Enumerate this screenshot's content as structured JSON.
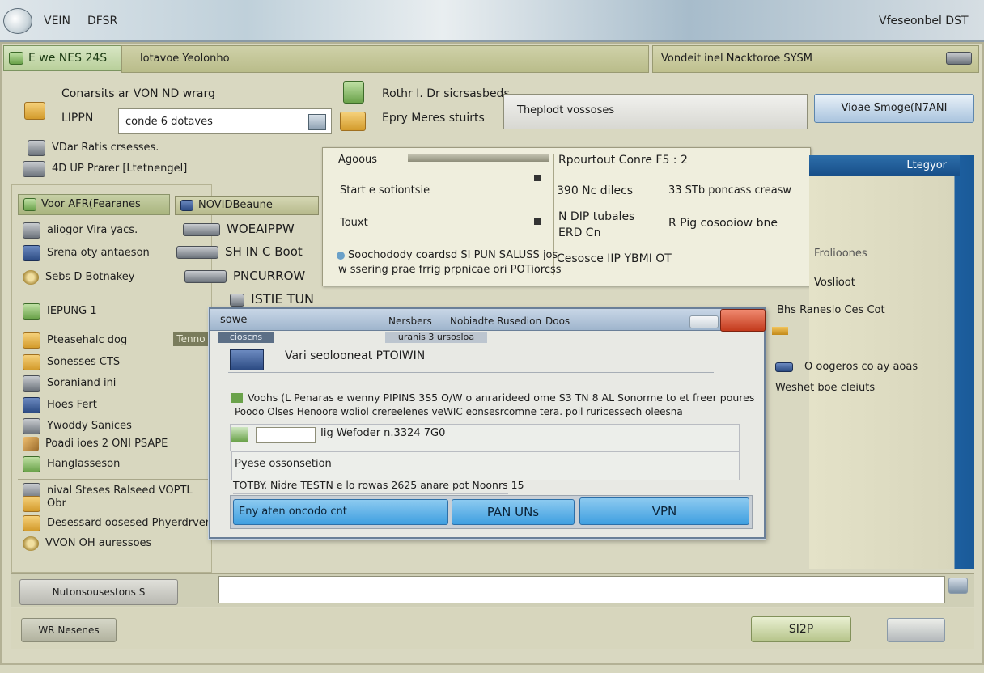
{
  "titlebar": {
    "left_text_1": "VEIN",
    "left_text_2": "DFSR",
    "right_text": "Vfeseonbel DST"
  },
  "topbar": {
    "tab_label": "E we NES 24S",
    "left_title": "lotavoe Yeolonho",
    "right_title": "Vondeit inel Nacktoroe SYSM"
  },
  "connect": {
    "label_1": "Conarsits ar VON ND wrarg",
    "label_2": "LIPPN",
    "input_value": "conde 6 dotaves"
  },
  "vpn_info": {
    "label_1": "Rothr I. Dr sicrsasbeds",
    "label_2": "Epry Meres stuirts",
    "search_value": "Theplodt vossoses"
  },
  "top_button": {
    "label": "Vioae Smoge(N7ANI"
  },
  "options": {
    "item_1": "VDar Ratis crsesses.",
    "item_2": "4D UP Prarer [Ltetnengel]"
  },
  "left_tree": {
    "header_1": "Voor AFR(Fearanes",
    "items_a": [
      "aliogor Vira yacs.",
      "Srena oty antaeson",
      "Sebs D Botnakey"
    ],
    "group_1": "IEPUNG 1",
    "items_b": [
      "Pteasehalc dog",
      "Sonesses CTS",
      "Soraniand ini",
      "Hoes Fert",
      "Ywoddy Sanices",
      "Poadi ioes 2 ONI PSAPE",
      "Hanglasseson"
    ],
    "group_2": "nival Steses Ralseed VOPTL",
    "items_c": [
      "Obr",
      "Desessard oosesed Phyerdrver",
      "VVON OH auressoes"
    ]
  },
  "mid_tree": {
    "header": "NOVIDBeaune",
    "items": [
      "WOEAIPPW",
      "SH IN C Boot",
      "PNCURROW",
      "ISTIE TUN"
    ],
    "tag": "Tenno"
  },
  "info_panel": {
    "col1": [
      "Agoous",
      "Start e sotiontsie",
      "Touxt"
    ],
    "footer_1": "Soochodody coardsd SI PUN SALUSS jos",
    "footer_2": "w ssering prae frrig prpnicae ori POTiorcss",
    "col2_head": "Rpourtout Conre F5 : 2",
    "col2": [
      "390 Nc dilecs",
      "N DIP tubales",
      "ERD Cn"
    ],
    "col3": [
      "33 STb poncass creasw",
      "R Pig cosooiow bne"
    ],
    "col_footer": "Cesosce IIP YBMI OT"
  },
  "right_panel": {
    "header": "Ltegyor",
    "items": [
      "Frolioones",
      "Voslioot",
      "Bhs Raneslo Ces Cot",
      "O oogeros co ay aoas",
      "Weshet boe cleiuts"
    ]
  },
  "dialog": {
    "title_left": "sowe",
    "title_mid_1": "Nersbers",
    "title_mid_2": "Nobiadte Rusedion",
    "title_mid_3": "Doos",
    "tab_active": "cioscns",
    "tab_2": "uranis 3 ursosloa",
    "heading": "Vari seolooneat PTOIWIN",
    "desc_1": "Voohs (L Penaras e wenny PIPINS 3S5 O/W o anrarideed ome S3 TN 8 AL Sonorme to et freer poures",
    "desc_2": "Poodo Olses Henoore woliol crereelenes veWIC eonsesrcomne tera. poil ruricessech oleesna",
    "field_label": "Iig Wefoder n.3324 7G0",
    "option_label": "Pyese ossonsetion",
    "status": "TOTBY. Nidre TESTN e lo rowas 2625 anare pot Noonrs 15",
    "btn_1": "Eny aten oncodo cnt",
    "btn_2": "PAN UNs",
    "btn_3": "VPN"
  },
  "bottom": {
    "left_label": "Nutonsousestons S",
    "status_left": "WR Nesenes",
    "btn_right": "SI2P"
  }
}
